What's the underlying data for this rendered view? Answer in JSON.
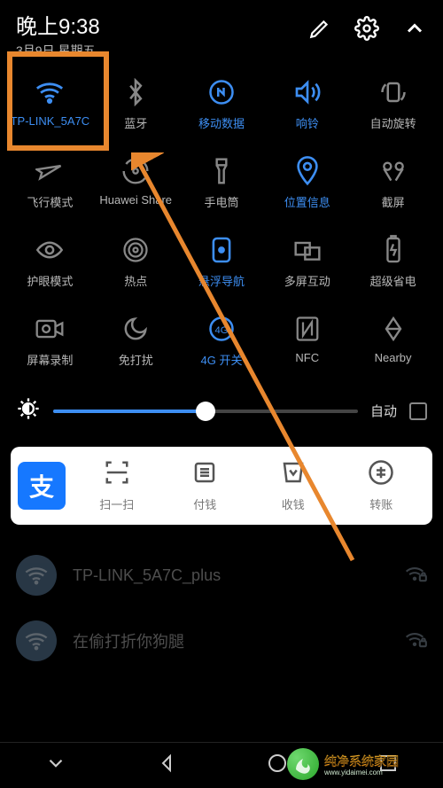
{
  "status": {
    "time": "晚上9:38",
    "date": "3月9日 星期五"
  },
  "colors": {
    "accent": "#3d8ef2",
    "highlight_border": "#e8872e",
    "app_brand": "#1678ff"
  },
  "tiles": [
    {
      "name": "wifi",
      "label": "TP-LINK_5A7C",
      "active": true
    },
    {
      "name": "bluetooth",
      "label": "蓝牙",
      "active": false
    },
    {
      "name": "mobile-data",
      "label": "移动数据",
      "active": true
    },
    {
      "name": "ringer",
      "label": "响铃",
      "active": true
    },
    {
      "name": "auto-rotate",
      "label": "自动旋转",
      "active": false
    },
    {
      "name": "airplane",
      "label": "飞行模式",
      "active": false
    },
    {
      "name": "huawei-share",
      "label": "Huawei Share",
      "active": false
    },
    {
      "name": "flashlight",
      "label": "手电筒",
      "active": false
    },
    {
      "name": "location",
      "label": "位置信息",
      "active": true
    },
    {
      "name": "screenshot",
      "label": "截屏",
      "active": false
    },
    {
      "name": "eye-comfort",
      "label": "护眼模式",
      "active": false
    },
    {
      "name": "hotspot",
      "label": "热点",
      "active": false
    },
    {
      "name": "float-nav",
      "label": "悬浮导航",
      "active": true
    },
    {
      "name": "multi-screen",
      "label": "多屏互动",
      "active": false
    },
    {
      "name": "power-saver",
      "label": "超级省电",
      "active": false
    },
    {
      "name": "screen-record",
      "label": "屏幕录制",
      "active": false
    },
    {
      "name": "dnd",
      "label": "免打扰",
      "active": false
    },
    {
      "name": "4g-switch",
      "label": "4G 开关",
      "active": true
    },
    {
      "name": "nfc",
      "label": "NFC",
      "active": false
    },
    {
      "name": "nearby",
      "label": "Nearby",
      "active": false
    }
  ],
  "brightness": {
    "value_pct": 50,
    "auto_label": "自动",
    "auto_checked": false
  },
  "app_panel": {
    "brand": "支",
    "actions": [
      {
        "name": "scan",
        "label": "扫一扫"
      },
      {
        "name": "pay",
        "label": "付钱"
      },
      {
        "name": "collect",
        "label": "收钱"
      },
      {
        "name": "transfer",
        "label": "转账"
      }
    ]
  },
  "wifi_list": [
    {
      "ssid": "TP-LINK_5A7C_plus"
    },
    {
      "ssid": "在偷打折你狗腿"
    }
  ],
  "watermark": {
    "title": "纯净系统家园",
    "url": "www.yidaimei.com"
  }
}
